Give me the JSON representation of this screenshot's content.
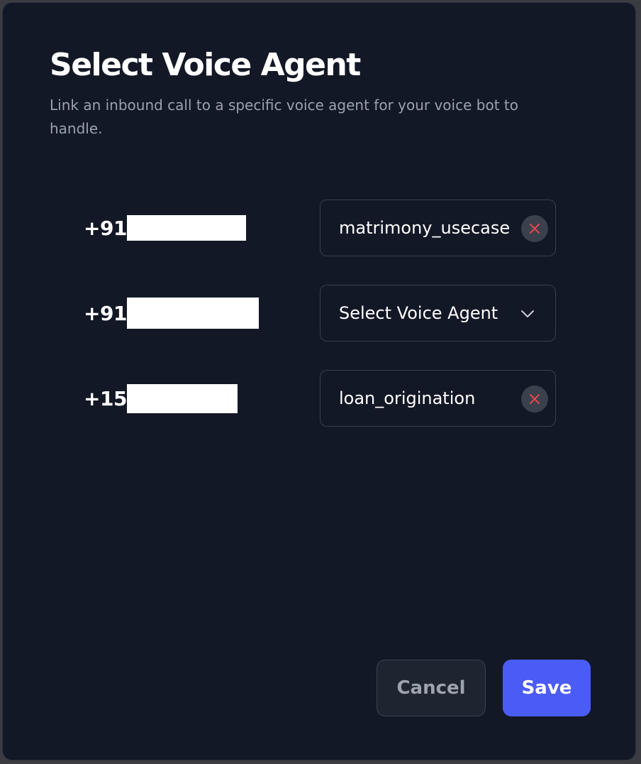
{
  "dialog": {
    "title": "Select Voice Agent",
    "subtitle": "Link an inbound call to a specific voice agent for your voice bot to handle."
  },
  "rows": [
    {
      "phone_prefix": "+91",
      "agent_value": "matrimony_usecase",
      "state": "selected"
    },
    {
      "phone_prefix": "+91",
      "agent_value": "Select Voice Agent",
      "state": "placeholder"
    },
    {
      "phone_prefix": "+15",
      "agent_value": "loan_origination",
      "state": "selected"
    }
  ],
  "icons": {
    "clear": "close-icon",
    "dropdown": "chevron-down-icon"
  },
  "colors": {
    "background": "#131826",
    "primary": "#4b5bf6",
    "clear_icon": "#e5484d",
    "muted_text": "#9ba1ad"
  },
  "actions": {
    "cancel_label": "Cancel",
    "save_label": "Save"
  }
}
